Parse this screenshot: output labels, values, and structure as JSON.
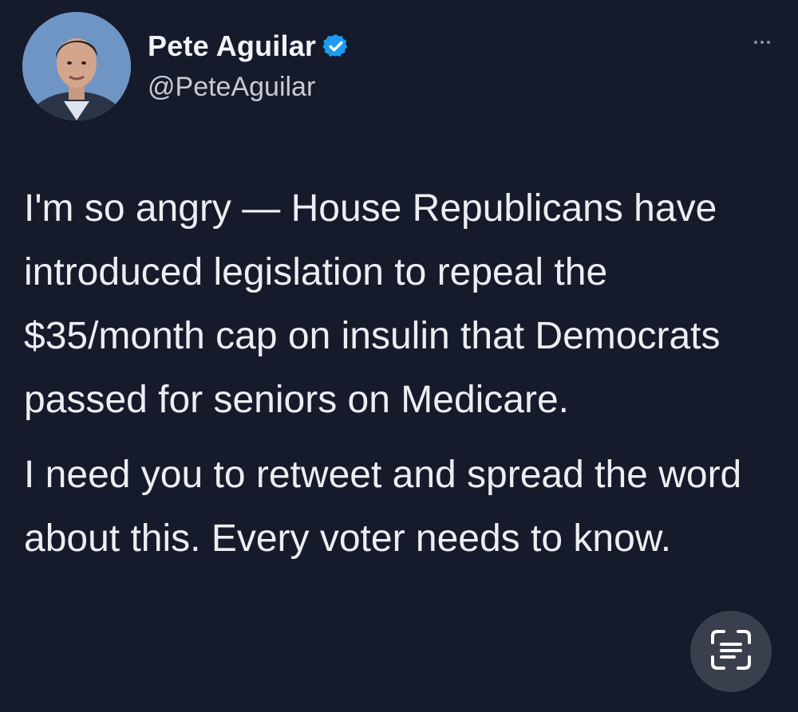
{
  "author": {
    "display_name": "Pete Aguilar",
    "handle": "@PeteAguilar",
    "verified": true
  },
  "tweet": {
    "paragraphs": [
      "I'm so angry — House Republicans have introduced legislation to repeal the $35/month cap on insulin that Democrats passed for seniors on Medicare.",
      "I need you to retweet and spread the word about this. Every voter needs to know."
    ]
  },
  "icons": {
    "verified": "verified-badge-icon",
    "more": "more-options-icon",
    "scan": "text-scan-icon"
  },
  "colors": {
    "background": "#151b2b",
    "verified_blue": "#1d9bf0"
  }
}
